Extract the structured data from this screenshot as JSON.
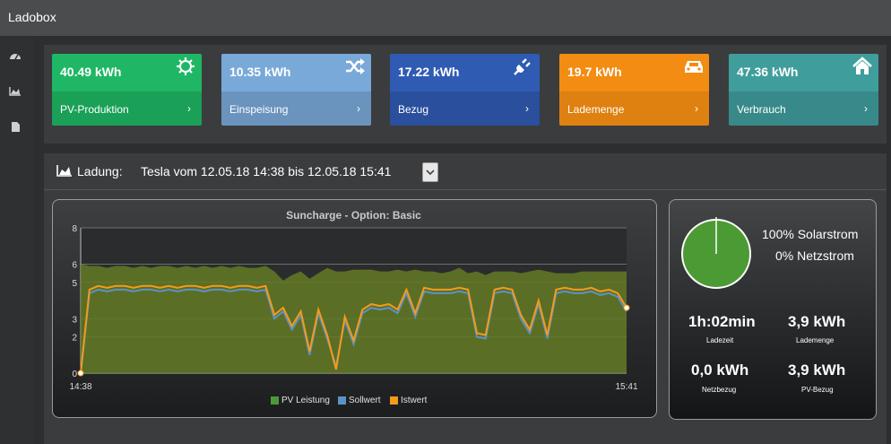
{
  "app": {
    "title": "Ladobox"
  },
  "sidebar": {
    "items": [
      {
        "icon": "dashboard-icon"
      },
      {
        "icon": "area-chart-icon"
      },
      {
        "icon": "document-icon"
      }
    ]
  },
  "cards": [
    {
      "value": "40.49 kWh",
      "label": "PV-Produktion",
      "color": "#1fb765",
      "icon": "gear-icon"
    },
    {
      "value": "10.35 kWh",
      "label": "Einspeisung",
      "color": "#79a9d9",
      "icon": "shuffle-icon"
    },
    {
      "value": "17.22 kWh",
      "label": "Bezug",
      "color": "#2f5bb3",
      "icon": "plug-icon"
    },
    {
      "value": "19.7 kWh",
      "label": "Lademenge",
      "color": "#f28c12",
      "icon": "car-icon"
    },
    {
      "value": "47.36 kWh",
      "label": "Verbrauch",
      "color": "#3f9e9c",
      "icon": "home-icon"
    }
  ],
  "ladung": {
    "label": "Ladung:",
    "value": "Tesla vom 12.05.18 14:38 bis 12.05.18 15:41"
  },
  "stats": {
    "solar": "100% Solarstrom",
    "netz": "0% Netzstrom",
    "solar_fraction": 1.0,
    "ladezeit_value": "1h:02min",
    "ladezeit_label": "Ladezeit",
    "lademenge_value": "3,9 kWh",
    "lademenge_label": "Lademenge",
    "netzbezug_value": "0,0 kWh",
    "netzbezug_label": "Netzbezug",
    "pvbezug_value": "3,9 kWh",
    "pvbezug_label": "PV-Bezug"
  },
  "chart_data": {
    "type": "area",
    "title": "Suncharge - Option: Basic",
    "ylim": [
      0,
      8
    ],
    "yticks": [
      "0",
      "2",
      "3",
      "5",
      "6",
      "8"
    ],
    "ytick_values": [
      0,
      2,
      3,
      5,
      6,
      8
    ],
    "x_start_label": "14:38",
    "x_end_label": "15:41",
    "grid": true,
    "legend_position": "bottom",
    "series": [
      {
        "name": "PV Leistung",
        "color": "#4a9a3a",
        "values": [
          6.0,
          5.9,
          5.9,
          5.8,
          5.9,
          5.9,
          5.8,
          5.9,
          5.8,
          5.9,
          5.9,
          5.8,
          5.9,
          5.8,
          5.9,
          5.8,
          5.9,
          5.8,
          5.9,
          5.8,
          5.8,
          5.9,
          5.6,
          5.1,
          5.4,
          5.6,
          5.2,
          5.5,
          5.8,
          5.6,
          5.6,
          5.7,
          5.7,
          5.7,
          5.6,
          5.6,
          5.7,
          5.6,
          5.7,
          5.6,
          5.6,
          5.5,
          5.6,
          5.8,
          5.5,
          5.6,
          5.4,
          5.6,
          5.6,
          5.6,
          5.5,
          5.6,
          5.7,
          5.6,
          5.5,
          5.5,
          5.5,
          5.6,
          5.6,
          5.6,
          5.6,
          5.6,
          5.6
        ]
      },
      {
        "name": "Sollwert",
        "color": "#5b92c7",
        "values": [
          0,
          4.4,
          4.6,
          4.5,
          4.6,
          4.6,
          4.5,
          4.6,
          4.6,
          4.5,
          4.6,
          4.5,
          4.6,
          4.6,
          4.5,
          4.6,
          4.6,
          4.5,
          4.6,
          4.6,
          4.5,
          4.6,
          3.0,
          3.4,
          2.4,
          3.2,
          1.0,
          3.3,
          1.9,
          0.4,
          2.9,
          1.6,
          3.3,
          3.6,
          3.5,
          3.6,
          3.3,
          4.4,
          3.1,
          4.5,
          4.4,
          4.4,
          4.4,
          4.5,
          4.4,
          2.0,
          1.9,
          4.4,
          4.5,
          4.4,
          3.0,
          2.2,
          3.8,
          1.9,
          4.4,
          4.5,
          4.4,
          4.4,
          4.5,
          4.3,
          4.4,
          4.2,
          3.4
        ]
      },
      {
        "name": "Istwert",
        "color": "#f59a1c",
        "values": [
          0,
          4.6,
          4.8,
          4.7,
          4.8,
          4.8,
          4.7,
          4.8,
          4.8,
          4.7,
          4.8,
          4.7,
          4.8,
          4.8,
          4.7,
          4.8,
          4.8,
          4.7,
          4.8,
          4.8,
          4.7,
          4.8,
          3.2,
          3.6,
          2.6,
          3.4,
          1.2,
          3.5,
          2.1,
          0.2,
          3.1,
          1.8,
          3.5,
          3.8,
          3.7,
          3.8,
          3.5,
          4.6,
          3.3,
          4.7,
          4.6,
          4.6,
          4.6,
          4.7,
          4.6,
          2.2,
          2.1,
          4.6,
          4.7,
          4.6,
          3.2,
          2.4,
          4.0,
          2.1,
          4.6,
          4.7,
          4.6,
          4.6,
          4.7,
          4.5,
          4.6,
          4.4,
          3.6
        ]
      }
    ]
  }
}
